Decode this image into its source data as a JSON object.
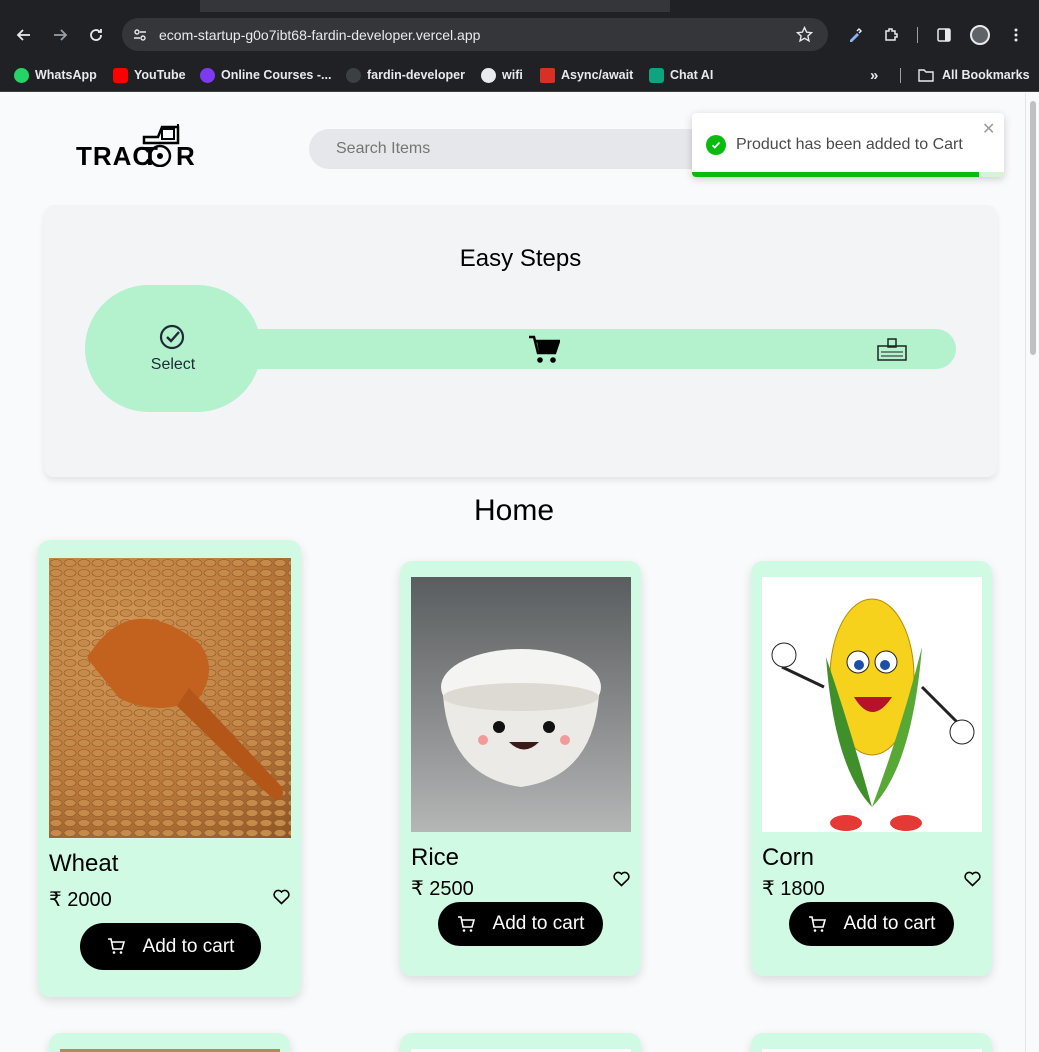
{
  "browser": {
    "url": "ecom-startup-g0o7ibt68-fardin-developer.vercel.app",
    "bookmarks": [
      {
        "label": "WhatsApp",
        "icon": "whatsapp-icon",
        "color": "#25d366"
      },
      {
        "label": "YouTube",
        "icon": "youtube-icon",
        "color": "#ff0000"
      },
      {
        "label": "Online Courses -...",
        "icon": "courses-icon",
        "color": "#7e3af2"
      },
      {
        "label": "fardin-developer",
        "icon": "github-icon",
        "color": "#3c4043"
      },
      {
        "label": "wifi",
        "icon": "globe-icon",
        "color": "#e8eaed"
      },
      {
        "label": "Async/await",
        "icon": "async-icon",
        "color": "#d93025"
      },
      {
        "label": "Chat AI",
        "icon": "chatgpt-icon",
        "color": "#10a37f"
      }
    ],
    "all_bookmarks_label": "All Bookmarks"
  },
  "header": {
    "logo_text": "TRACTOR",
    "search_placeholder": "Search Items"
  },
  "toast": {
    "message": "Product has been added to Cart",
    "progress": 0.92,
    "accent": "#07bc0c"
  },
  "steps": {
    "title": "Easy Steps",
    "select_label": "Select",
    "accent": "#b3f2cc"
  },
  "home": {
    "title": "Home",
    "currency": "₹",
    "add_to_cart_label": "Add to cart",
    "products": [
      {
        "name": "Wheat",
        "price": "₹ 2000"
      },
      {
        "name": "Rice",
        "price": "₹ 2500"
      },
      {
        "name": "Corn",
        "price": "₹ 1800"
      }
    ]
  }
}
